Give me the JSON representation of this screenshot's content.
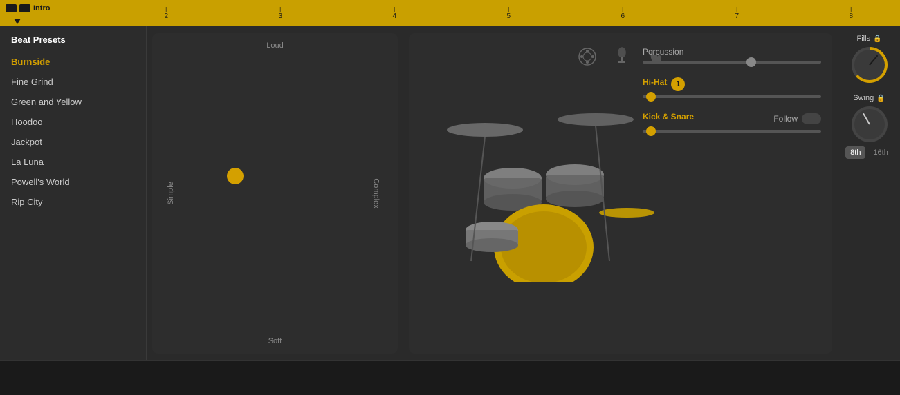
{
  "timeline": {
    "label": "Intro",
    "markers": [
      "2",
      "3",
      "4",
      "5",
      "6",
      "7",
      "8"
    ]
  },
  "sidebar": {
    "title": "Beat Presets",
    "items": [
      {
        "label": "Burnside",
        "active": true
      },
      {
        "label": "Fine Grind",
        "active": false
      },
      {
        "label": "Green and Yellow",
        "active": false
      },
      {
        "label": "Hoodoo",
        "active": false
      },
      {
        "label": "Jackpot",
        "active": false
      },
      {
        "label": "La Luna",
        "active": false
      },
      {
        "label": "Powell's World",
        "active": false
      },
      {
        "label": "Rip City",
        "active": false
      }
    ]
  },
  "pad": {
    "loud": "Loud",
    "soft": "Soft",
    "simple": "Simple",
    "complex": "Complex"
  },
  "controls": {
    "percussion_label": "Percussion",
    "hihat_label": "Hi-Hat",
    "hihat_badge": "1",
    "kick_snare_label": "Kick & Snare",
    "follow_label": "Follow"
  },
  "fills": {
    "label": "Fills",
    "lock": "🔒"
  },
  "swing": {
    "label": "Swing",
    "lock": "🔒",
    "btn_8th": "8th",
    "btn_16th": "16th"
  }
}
